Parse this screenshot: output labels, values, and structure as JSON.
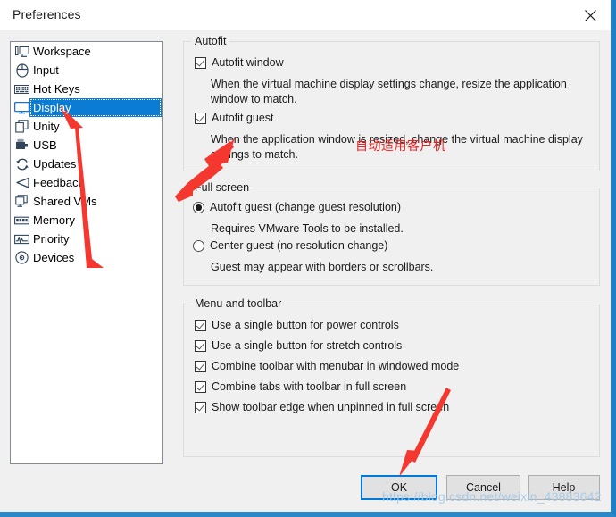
{
  "window": {
    "title": "Preferences",
    "close_icon": "close-icon",
    "accent_color": "#0078d7",
    "border_color": "#1f7fc4",
    "dialog_background": "#f0f0f0"
  },
  "sidebar": {
    "selected": "Display",
    "items": [
      {
        "label": "Workspace",
        "icon": "workspace-icon"
      },
      {
        "label": "Input",
        "icon": "mouse-icon"
      },
      {
        "label": "Hot Keys",
        "icon": "keyboard-icon"
      },
      {
        "label": "Display",
        "icon": "monitor-icon"
      },
      {
        "label": "Unity",
        "icon": "windows-stack-icon"
      },
      {
        "label": "USB",
        "icon": "usb-icon"
      },
      {
        "label": "Updates",
        "icon": "refresh-icon"
      },
      {
        "label": "Feedback",
        "icon": "megaphone-icon"
      },
      {
        "label": "Shared VMs",
        "icon": "shared-vm-icon"
      },
      {
        "label": "Memory",
        "icon": "memory-icon"
      },
      {
        "label": "Priority",
        "icon": "waveform-icon"
      },
      {
        "label": "Devices",
        "icon": "disc-icon"
      }
    ]
  },
  "autofit": {
    "title": "Autofit",
    "window_checkbox": {
      "label": "Autofit window",
      "checked": true
    },
    "window_desc": "When the virtual machine display settings change, resize the application window to match.",
    "guest_checkbox": {
      "label": "Autofit guest",
      "checked": true
    },
    "guest_desc": "When the application window is resized, change the virtual machine display settings to match."
  },
  "full_screen": {
    "title": "Full screen",
    "option_autofit": {
      "label": "Autofit guest (change guest resolution)",
      "selected": true
    },
    "option_autofit_desc": "Requires VMware Tools to be installed.",
    "option_center": {
      "label": "Center guest (no resolution change)",
      "selected": false
    },
    "option_center_desc": "Guest may appear with borders or scrollbars."
  },
  "menu_toolbar": {
    "title": "Menu and toolbar",
    "options": [
      {
        "label": "Use a single button for power controls",
        "checked": true
      },
      {
        "label": "Use a single button for stretch controls",
        "checked": true
      },
      {
        "label": "Combine toolbar with menubar in windowed mode",
        "checked": true
      },
      {
        "label": "Combine tabs with toolbar in full screen",
        "checked": true
      },
      {
        "label": "Show toolbar edge when unpinned in full screen",
        "checked": true
      }
    ]
  },
  "buttons": {
    "ok": "OK",
    "cancel": "Cancel",
    "help": "Help"
  },
  "annotations": {
    "red_note": "自动适用客户机",
    "red_color": "#ee2222",
    "watermark": "https://blog.csdn.net/weixin_43883642"
  }
}
